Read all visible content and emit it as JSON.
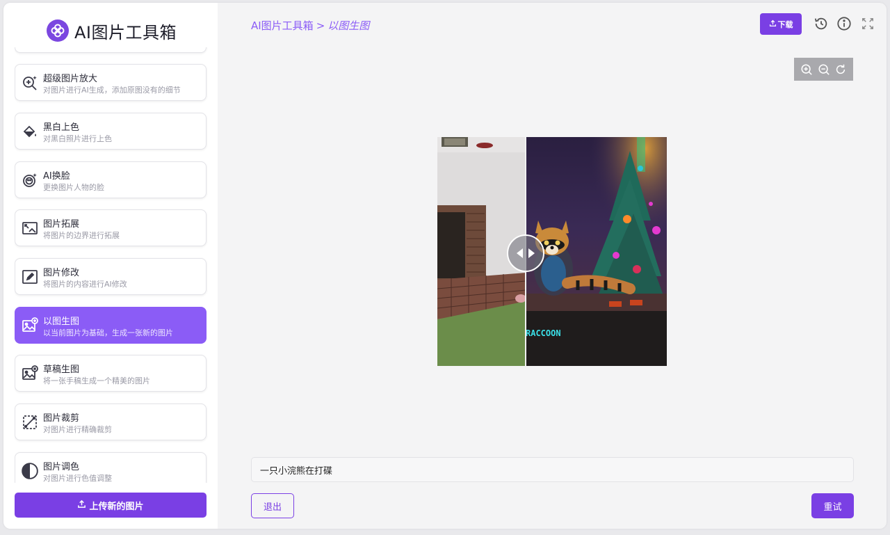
{
  "app": {
    "title": "AI图片工具箱"
  },
  "sidebar": {
    "tools": [
      {
        "title": "超级图片放大",
        "desc": "对图片进行AI生成，添加原图没有的细节",
        "icon": "zoom-plus-sparkle-icon"
      },
      {
        "title": "黑白上色",
        "desc": "对黑白照片进行上色",
        "icon": "paint-bucket-icon"
      },
      {
        "title": "AI换脸",
        "desc": "更换图片人物的脸",
        "icon": "face-swap-icon"
      },
      {
        "title": "图片拓展",
        "desc": "将图片的边界进行拓展",
        "icon": "image-expand-icon"
      },
      {
        "title": "图片修改",
        "desc": "将图片的内容进行AI修改",
        "icon": "image-edit-icon"
      },
      {
        "title": "以图生图",
        "desc": "以当前图片为基础，生成一张新的图片",
        "icon": "image-to-image-icon",
        "active": true
      },
      {
        "title": "草稿生图",
        "desc": "将一张手稿生成一个精美的图片",
        "icon": "sketch-to-image-icon"
      },
      {
        "title": "图片裁剪",
        "desc": "对图片进行精确裁剪",
        "icon": "crop-icon"
      },
      {
        "title": "图片调色",
        "desc": "对图片进行色值调整",
        "icon": "color-adjust-icon"
      }
    ],
    "upload_label": "上传新的图片"
  },
  "header": {
    "breadcrumb_root": "AI图片工具箱",
    "breadcrumb_sep": ">",
    "breadcrumb_current": "以图生图",
    "download_label": "下载"
  },
  "canvas": {
    "after_image_text": "RACCOON"
  },
  "prompt": {
    "value": "一只小浣熊在打碟"
  },
  "actions": {
    "exit_label": "退出",
    "retry_label": "重试"
  },
  "colors": {
    "accent": "#7a3fe4",
    "active_card": "#8b5cf6"
  }
}
